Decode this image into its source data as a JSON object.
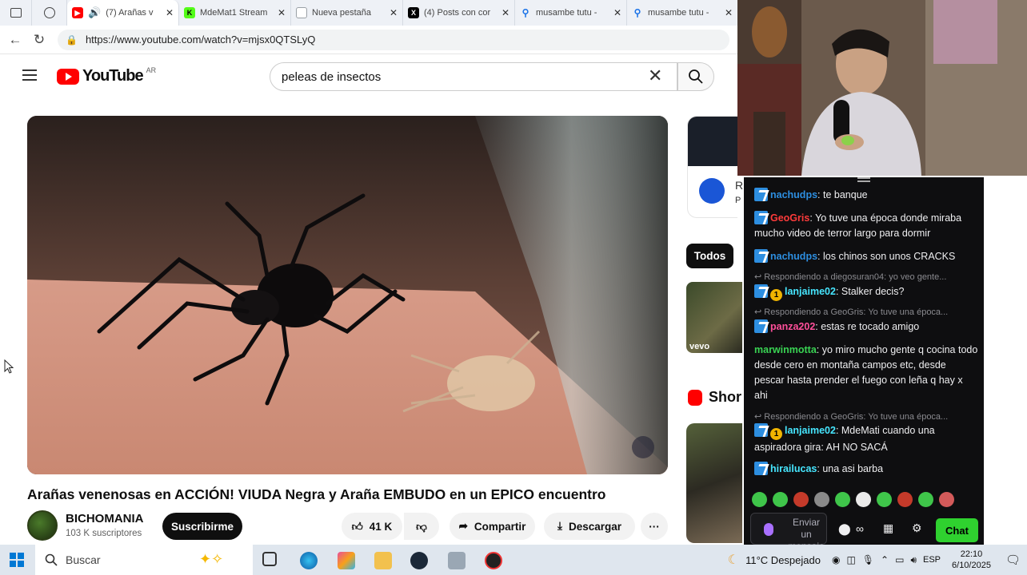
{
  "browser": {
    "tabs": [
      {
        "title": "(7) Arañas v",
        "icon": "youtube-icon",
        "color": "#ff0000",
        "active": true
      },
      {
        "title": "MdeMat1 Stream",
        "icon": "kick-icon",
        "color": "#53fc18",
        "active": false
      },
      {
        "title": "Nueva pestaña",
        "icon": "new-tab-icon",
        "color": "#9aa0a6",
        "active": false
      },
      {
        "title": "(4) Posts con cor",
        "icon": "x-icon",
        "color": "#000000",
        "active": false
      },
      {
        "title": "musambe tutu -",
        "icon": "search-icon",
        "color": "#1a73e8",
        "active": false
      },
      {
        "title": "musambe tutu -",
        "icon": "search-icon",
        "color": "#1a73e8",
        "active": false
      }
    ],
    "url": "https://www.youtube.com/watch?v=mjsx0QTSLyQ"
  },
  "youtube": {
    "logo_text": "YouTube",
    "country": "AR",
    "search_value": "peleas de insectos",
    "video_title": "Arañas venenosas en ACCIÓN! VIUDA Negra y Araña EMBUDO en un EPICO encuentro",
    "channel_name": "BICHOMANIA",
    "channel_subs": "103 K suscriptores",
    "subscribe_label": "Suscribirme",
    "likes": "41 K",
    "share_label": "Compartir",
    "download_label": "Descargar",
    "more_label": "···",
    "sidebar": {
      "card_partial": "R",
      "card_partial2": "P",
      "chip_all": "Todos",
      "vevo": "vevo",
      "shorts_title": "Shor"
    }
  },
  "chat": {
    "messages": [
      {
        "user": "nachudps",
        "color": "#2d8ee0",
        "badge": "bdg",
        "text": "te banque"
      },
      {
        "user": "GeoGris",
        "color": "#ff3b3b",
        "badge": "bdg",
        "text": "Yo tuve una época donde miraba mucho video de terror largo para dormir"
      },
      {
        "user": "nachudps",
        "color": "#2d8ee0",
        "badge": "bdg",
        "text": "los chinos son unos CRACKS"
      },
      {
        "reply": "Respondiendo a diegosuran04: yo veo gente..."
      },
      {
        "user": "lanjaime02",
        "color": "#46e6ff",
        "badge": "bdg-sub",
        "text": "Stalker decis?"
      },
      {
        "reply": "Respondiendo a GeoGris: Yo tuve una época..."
      },
      {
        "user": "panza202",
        "color": "#ff4f9a",
        "badge": "bdg",
        "text": "estas re tocado amigo"
      },
      {
        "user": "marwinmotta",
        "color": "#39d353",
        "badge": "none",
        "text": "yo miro mucho gente q cocina todo desde cero en montaña campos etc, desde pescar hasta prender el fuego con leña q hay x ahi"
      },
      {
        "reply": "Respondiendo a GeoGris: Yo tuve una época..."
      },
      {
        "user": "lanjaime02",
        "color": "#46e6ff",
        "badge": "bdg-sub",
        "text": "MdeMati cuando una aspiradora gira: AH NO SACÁ"
      },
      {
        "user": "hirailucas",
        "color": "#46e6ff",
        "badge": "bdg",
        "text": "una asi barba"
      }
    ],
    "input_placeholder": "Enviar un mensaje",
    "chat_button": "Chat",
    "sub_months": "1"
  },
  "taskbar": {
    "search_placeholder": "Buscar",
    "weather": "11°C Despejado",
    "lang": "ESP",
    "time": "22:10",
    "date": "6/10/2025"
  }
}
